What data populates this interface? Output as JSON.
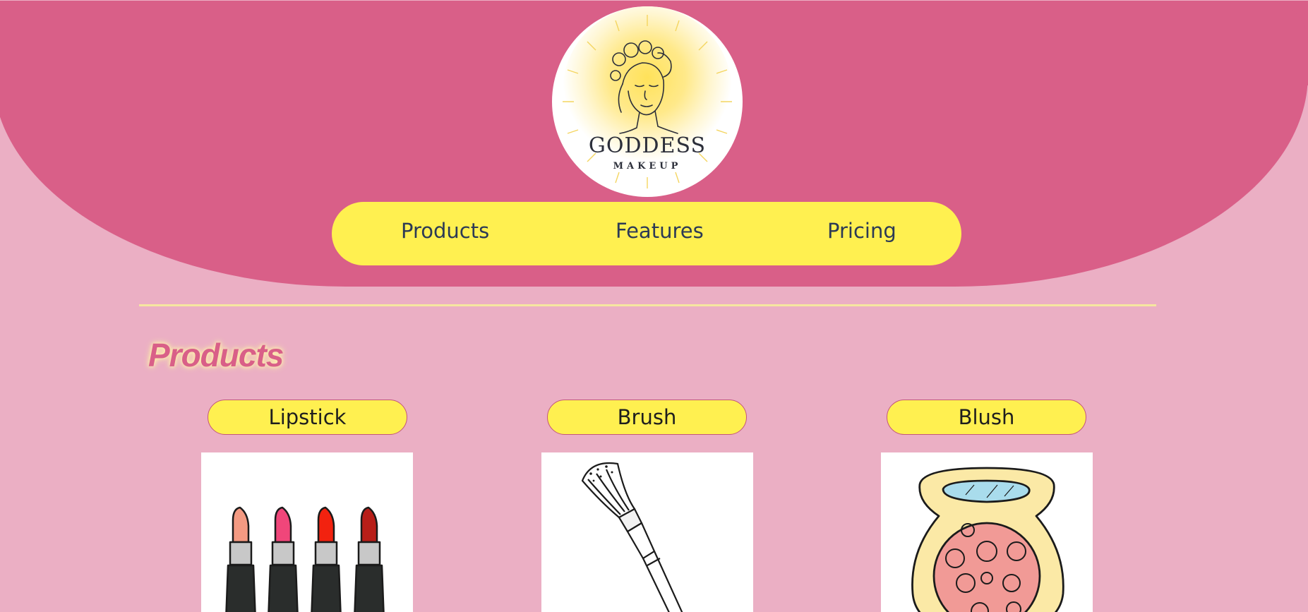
{
  "brand": {
    "name": "GODDESS",
    "tagline": "MAKEUP"
  },
  "nav": {
    "items": [
      {
        "label": "Products"
      },
      {
        "label": "Features"
      },
      {
        "label": "Pricing"
      }
    ]
  },
  "products_section": {
    "title": "Products",
    "items": [
      {
        "label": "Lipstick",
        "icon": "lipstick-icon"
      },
      {
        "label": "Brush",
        "icon": "makeup-brush-icon"
      },
      {
        "label": "Blush",
        "icon": "blush-compact-icon"
      }
    ]
  },
  "colors": {
    "page_background": "#ebafc4",
    "header_background": "#d95f88",
    "nav_background": "#fff050",
    "title_pink": "#d95f88",
    "divider": "#f5e7a0"
  }
}
